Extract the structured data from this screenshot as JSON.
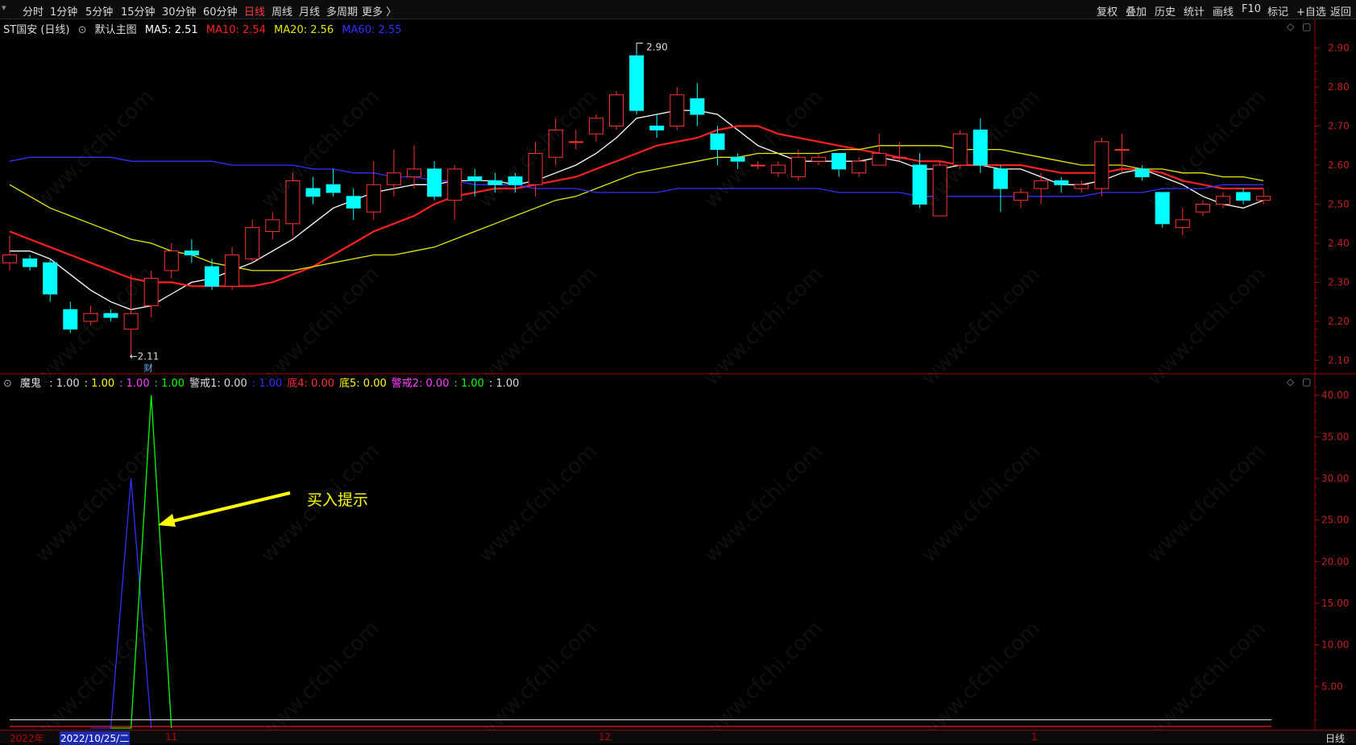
{
  "toolbar": {
    "periods": [
      "分时",
      "1分钟",
      "5分钟",
      "15分钟",
      "30分钟",
      "60分钟",
      "日线",
      "周线",
      "月线",
      "多周期",
      "更多 〉"
    ],
    "active_period": "日线",
    "right_items": [
      "复权",
      "叠加",
      "历史",
      "统计",
      "画线",
      "F10",
      "标记",
      "+自选",
      "返回"
    ]
  },
  "main_legend": {
    "stock": "ST国安 (日线)",
    "indicator": "默认主图",
    "ma5": "MA5: 2.51",
    "ma10": "MA10: 2.54",
    "ma20": "MA20: 2.56",
    "ma60": "MA60: 2.55"
  },
  "sub_legend": {
    "name": "魔鬼",
    "items": [
      {
        "text": ": 1.00",
        "color": "#dddddd"
      },
      {
        "text": ": 1.00",
        "color": "#ffff00"
      },
      {
        "text": ": 1.00",
        "color": "#ff40ff"
      },
      {
        "text": ": 1.00",
        "color": "#00ff00"
      },
      {
        "text": "警戒1: 0.00",
        "color": "#dddddd"
      },
      {
        "text": ": 1.00",
        "color": "#3030ff"
      },
      {
        "text": "底4: 0.00",
        "color": "#ff3030"
      },
      {
        "text": "底5: 0.00",
        "color": "#ffff00"
      },
      {
        "text": "警戒2: 0.00",
        "color": "#ff40ff"
      },
      {
        "text": ": 1.00",
        "color": "#00ff00"
      },
      {
        "text": ": 1.00",
        "color": "#dddddd"
      }
    ]
  },
  "annotations": {
    "high_label": "2.90",
    "low_label": "2.11",
    "finance_mark": "财",
    "buy_hint": "买入提示"
  },
  "watermark": "www.cfchi.com",
  "bottom": {
    "year": "2022年",
    "cursor_date": "2022/10/25/二",
    "month_labels": [
      "11",
      "12",
      "1"
    ],
    "period_label": "日线"
  },
  "colors": {
    "up": "#ff3232",
    "down": "#00ffff",
    "ma5": "#ffffff",
    "ma10": "#ff2020",
    "ma20": "#e6e600",
    "ma60": "#3030ff",
    "axis": "#b00000",
    "buy_hint": "#ffff00"
  },
  "chart_data": [
    {
      "type": "candlestick",
      "title": "ST国安 (日线)",
      "ylim": [
        2.07,
        2.93
      ],
      "y_ticks": [
        2.1,
        2.2,
        2.3,
        2.4,
        2.5,
        2.6,
        2.7,
        2.8,
        2.9
      ],
      "ohlc": [
        [
          2.35,
          2.37,
          2.33,
          2.42
        ],
        [
          2.36,
          2.34,
          2.33,
          2.37
        ],
        [
          2.35,
          2.27,
          2.25,
          2.36
        ],
        [
          2.23,
          2.18,
          2.17,
          2.25
        ],
        [
          2.2,
          2.22,
          2.19,
          2.24
        ],
        [
          2.22,
          2.21,
          2.2,
          2.23
        ],
        [
          2.18,
          2.22,
          2.11,
          2.32
        ],
        [
          2.24,
          2.31,
          2.21,
          2.33
        ],
        [
          2.33,
          2.38,
          2.31,
          2.4
        ],
        [
          2.38,
          2.37,
          2.35,
          2.41
        ],
        [
          2.34,
          2.29,
          2.28,
          2.36
        ],
        [
          2.29,
          2.37,
          2.28,
          2.39
        ],
        [
          2.36,
          2.44,
          2.35,
          2.46
        ],
        [
          2.43,
          2.46,
          2.41,
          2.48
        ],
        [
          2.45,
          2.56,
          2.42,
          2.58
        ],
        [
          2.54,
          2.52,
          2.5,
          2.57
        ],
        [
          2.55,
          2.53,
          2.52,
          2.59
        ],
        [
          2.52,
          2.49,
          2.46,
          2.54
        ],
        [
          2.48,
          2.55,
          2.46,
          2.61
        ],
        [
          2.55,
          2.58,
          2.52,
          2.64
        ],
        [
          2.57,
          2.59,
          2.54,
          2.65
        ],
        [
          2.59,
          2.52,
          2.51,
          2.61
        ],
        [
          2.51,
          2.59,
          2.46,
          2.6
        ],
        [
          2.57,
          2.56,
          2.52,
          2.59
        ],
        [
          2.56,
          2.55,
          2.53,
          2.58
        ],
        [
          2.57,
          2.55,
          2.53,
          2.58
        ],
        [
          2.55,
          2.63,
          2.52,
          2.66
        ],
        [
          2.62,
          2.69,
          2.6,
          2.72
        ],
        [
          2.66,
          2.66,
          2.64,
          2.69
        ],
        [
          2.68,
          2.72,
          2.66,
          2.73
        ],
        [
          2.7,
          2.78,
          2.69,
          2.79
        ],
        [
          2.88,
          2.74,
          2.73,
          2.9
        ],
        [
          2.7,
          2.69,
          2.67,
          2.73
        ],
        [
          2.7,
          2.78,
          2.69,
          2.8
        ],
        [
          2.77,
          2.73,
          2.7,
          2.81
        ],
        [
          2.68,
          2.64,
          2.6,
          2.7
        ],
        [
          2.62,
          2.61,
          2.59,
          2.63
        ],
        [
          2.6,
          2.6,
          2.59,
          2.61
        ],
        [
          2.58,
          2.6,
          2.57,
          2.61
        ],
        [
          2.57,
          2.62,
          2.56,
          2.64
        ],
        [
          2.61,
          2.62,
          2.6,
          2.63
        ],
        [
          2.63,
          2.59,
          2.57,
          2.63
        ],
        [
          2.58,
          2.61,
          2.57,
          2.62
        ],
        [
          2.6,
          2.63,
          2.6,
          2.68
        ],
        [
          2.62,
          2.62,
          2.61,
          2.66
        ],
        [
          2.6,
          2.5,
          2.49,
          2.63
        ],
        [
          2.47,
          2.6,
          2.47,
          2.61
        ],
        [
          2.6,
          2.68,
          2.59,
          2.69
        ],
        [
          2.69,
          2.6,
          2.58,
          2.72
        ],
        [
          2.59,
          2.54,
          2.48,
          2.6
        ],
        [
          2.51,
          2.53,
          2.49,
          2.54
        ],
        [
          2.54,
          2.56,
          2.5,
          2.58
        ],
        [
          2.56,
          2.55,
          2.53,
          2.57
        ],
        [
          2.54,
          2.55,
          2.53,
          2.56
        ],
        [
          2.54,
          2.66,
          2.52,
          2.67
        ],
        [
          2.64,
          2.64,
          2.58,
          2.68
        ],
        [
          2.59,
          2.57,
          2.56,
          2.6
        ],
        [
          2.53,
          2.45,
          2.44,
          2.53
        ],
        [
          2.44,
          2.46,
          2.42,
          2.49
        ],
        [
          2.48,
          2.5,
          2.47,
          2.51
        ],
        [
          2.5,
          2.52,
          2.49,
          2.53
        ],
        [
          2.53,
          2.51,
          2.5,
          2.54
        ],
        [
          2.51,
          2.52,
          2.5,
          2.54
        ]
      ],
      "series": [
        {
          "name": "MA5",
          "color": "#ffffff",
          "values": [
            2.38,
            2.38,
            2.36,
            2.32,
            2.28,
            2.25,
            2.23,
            2.24,
            2.27,
            2.3,
            2.31,
            2.33,
            2.35,
            2.38,
            2.41,
            2.45,
            2.49,
            2.51,
            2.53,
            2.54,
            2.55,
            2.55,
            2.56,
            2.56,
            2.56,
            2.55,
            2.56,
            2.58,
            2.6,
            2.63,
            2.67,
            2.72,
            2.73,
            2.74,
            2.74,
            2.73,
            2.69,
            2.65,
            2.63,
            2.61,
            2.61,
            2.61,
            2.61,
            2.62,
            2.61,
            2.59,
            2.59,
            2.6,
            2.6,
            2.59,
            2.59,
            2.57,
            2.55,
            2.55,
            2.56,
            2.58,
            2.59,
            2.57,
            2.55,
            2.52,
            2.5,
            2.49,
            2.51
          ]
        },
        {
          "name": "MA10",
          "color": "#ff2020",
          "values": [
            2.43,
            2.41,
            2.39,
            2.37,
            2.35,
            2.33,
            2.31,
            2.3,
            2.3,
            2.29,
            2.29,
            2.29,
            2.29,
            2.3,
            2.32,
            2.34,
            2.37,
            2.4,
            2.43,
            2.45,
            2.47,
            2.5,
            2.52,
            2.53,
            2.54,
            2.54,
            2.55,
            2.56,
            2.57,
            2.59,
            2.61,
            2.63,
            2.65,
            2.66,
            2.67,
            2.69,
            2.7,
            2.7,
            2.68,
            2.67,
            2.66,
            2.65,
            2.64,
            2.63,
            2.62,
            2.61,
            2.61,
            2.6,
            2.6,
            2.6,
            2.6,
            2.59,
            2.58,
            2.58,
            2.58,
            2.59,
            2.59,
            2.58,
            2.56,
            2.55,
            2.54,
            2.54,
            2.54
          ]
        },
        {
          "name": "MA20",
          "color": "#e6e600",
          "values": [
            2.55,
            2.52,
            2.49,
            2.47,
            2.45,
            2.43,
            2.41,
            2.4,
            2.38,
            2.37,
            2.35,
            2.34,
            2.33,
            2.33,
            2.33,
            2.34,
            2.35,
            2.36,
            2.37,
            2.37,
            2.38,
            2.39,
            2.41,
            2.43,
            2.45,
            2.47,
            2.49,
            2.51,
            2.52,
            2.54,
            2.56,
            2.58,
            2.59,
            2.6,
            2.61,
            2.62,
            2.62,
            2.63,
            2.63,
            2.63,
            2.63,
            2.64,
            2.64,
            2.65,
            2.65,
            2.65,
            2.65,
            2.64,
            2.64,
            2.64,
            2.63,
            2.62,
            2.61,
            2.6,
            2.6,
            2.6,
            2.59,
            2.59,
            2.58,
            2.58,
            2.57,
            2.57,
            2.56
          ]
        },
        {
          "name": "MA60",
          "color": "#3030ff",
          "values": [
            2.61,
            2.62,
            2.62,
            2.62,
            2.62,
            2.62,
            2.61,
            2.61,
            2.61,
            2.61,
            2.61,
            2.6,
            2.6,
            2.6,
            2.6,
            2.59,
            2.59,
            2.58,
            2.58,
            2.57,
            2.57,
            2.56,
            2.56,
            2.55,
            2.55,
            2.55,
            2.54,
            2.54,
            2.54,
            2.53,
            2.53,
            2.53,
            2.53,
            2.54,
            2.54,
            2.54,
            2.54,
            2.54,
            2.54,
            2.54,
            2.54,
            2.53,
            2.53,
            2.53,
            2.53,
            2.52,
            2.52,
            2.52,
            2.52,
            2.52,
            2.52,
            2.52,
            2.52,
            2.52,
            2.53,
            2.53,
            2.53,
            2.54,
            2.54,
            2.54,
            2.55,
            2.55,
            2.55
          ]
        }
      ]
    },
    {
      "type": "line",
      "title": "魔鬼",
      "ylim": [
        0,
        42
      ],
      "y_ticks": [
        5,
        10,
        15,
        20,
        25,
        30,
        35,
        40
      ],
      "series": [
        {
          "name": "",
          "color": "#3030ff",
          "points": [
            [
              4,
              0
            ],
            [
              5,
              0
            ],
            [
              6,
              30
            ],
            [
              7,
              0
            ]
          ]
        },
        {
          "name": "",
          "color": "#00ff00",
          "points": [
            [
              5,
              0
            ],
            [
              6,
              0
            ],
            [
              7,
              40
            ],
            [
              8,
              0
            ]
          ]
        },
        {
          "name": "",
          "color": "#dddddd",
          "level": 1
        },
        {
          "name": "",
          "color": "#ff2020",
          "level": 0.2
        }
      ]
    }
  ]
}
